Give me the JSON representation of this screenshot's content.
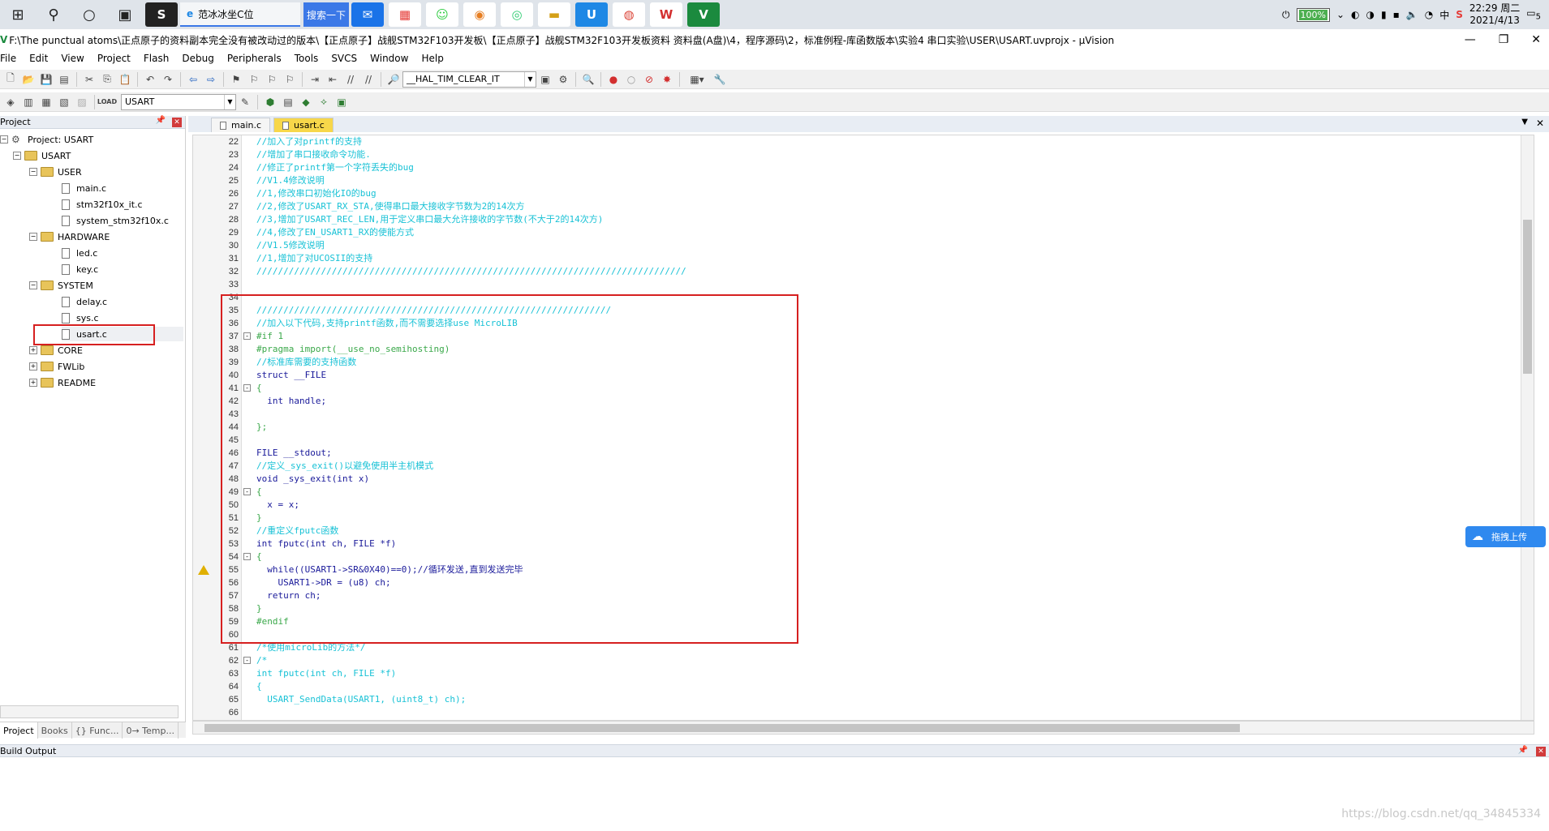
{
  "taskbar": {
    "ie_tab_label": "范冰冰坐C位",
    "search_label": "搜索一下",
    "battery": "100%",
    "time": "22:29 周二",
    "date": "2021/4/13",
    "notification_count": "5"
  },
  "window": {
    "title": "F:\\The punctual atoms\\正点原子的资料副本完全没有被改动过的版本\\【正点原子】战舰STM32F103开发板\\【正点原子】战舰STM32F103开发板资料 资料盘(A盘)\\4，程序源码\\2，标准例程-库函数版本\\实验4 串口实验\\USER\\USART.uvprojx - µVision"
  },
  "menu": [
    "File",
    "Edit",
    "View",
    "Project",
    "Flash",
    "Debug",
    "Peripherals",
    "Tools",
    "SVCS",
    "Window",
    "Help"
  ],
  "toolbar": {
    "find_combo": "__HAL_TIM_CLEAR_IT",
    "target_combo": "USART"
  },
  "project_panel": {
    "header": "Project",
    "root": "Project: USART",
    "target": "USART",
    "groups": [
      {
        "name": "USER",
        "files": [
          "main.c",
          "stm32f10x_it.c",
          "system_stm32f10x.c"
        ]
      },
      {
        "name": "HARDWARE",
        "files": [
          "led.c",
          "key.c"
        ]
      },
      {
        "name": "SYSTEM",
        "files": [
          "delay.c",
          "sys.c",
          "usart.c"
        ]
      },
      {
        "name": "CORE",
        "files": []
      },
      {
        "name": "FWLib",
        "files": []
      },
      {
        "name": "README",
        "files": []
      }
    ],
    "tabs": [
      "Project",
      "Books",
      "{} Func...",
      "0→ Temp..."
    ]
  },
  "editor": {
    "tabs": [
      "main.c",
      "usart.c"
    ],
    "lines": [
      {
        "n": "22",
        "t": "//加入了对printf的支持",
        "c": "comment"
      },
      {
        "n": "23",
        "t": "//增加了串口接收命令功能.",
        "c": "comment"
      },
      {
        "n": "24",
        "t": "//修正了printf第一个字符丢失的bug",
        "c": "comment"
      },
      {
        "n": "25",
        "t": "//V1.4修改说明",
        "c": "comment"
      },
      {
        "n": "26",
        "t": "//1,修改串口初始化IO的bug",
        "c": "comment"
      },
      {
        "n": "27",
        "t": "//2,修改了USART_RX_STA,使得串口最大接收字节数为2的14次方",
        "c": "comment"
      },
      {
        "n": "28",
        "t": "//3,增加了USART_REC_LEN,用于定义串口最大允许接收的字节数(不大于2的14次方)",
        "c": "comment"
      },
      {
        "n": "29",
        "t": "//4,修改了EN_USART1_RX的使能方式",
        "c": "comment"
      },
      {
        "n": "30",
        "t": "//V1.5修改说明",
        "c": "comment"
      },
      {
        "n": "31",
        "t": "//1,增加了对UCOSII的支持",
        "c": "comment"
      },
      {
        "n": "32",
        "t": "////////////////////////////////////////////////////////////////////////////////",
        "c": "comment"
      },
      {
        "n": "33",
        "t": "",
        "c": "plain"
      },
      {
        "n": "34",
        "t": "",
        "c": "plain"
      },
      {
        "n": "35",
        "t": "//////////////////////////////////////////////////////////////////",
        "c": "comment"
      },
      {
        "n": "36",
        "t": "//加入以下代码,支持printf函数,而不需要选择use MicroLIB",
        "c": "comment"
      },
      {
        "n": "37",
        "t": "#if 1",
        "c": "pp",
        "fold": "-"
      },
      {
        "n": "38",
        "t": "#pragma import(__use_no_semihosting)",
        "c": "pp"
      },
      {
        "n": "39",
        "t": "//标准库需要的支持函数",
        "c": "comment"
      },
      {
        "n": "40",
        "t": "struct __FILE",
        "c": "kw"
      },
      {
        "n": "41",
        "t": "{",
        "c": "pp",
        "fold": "-"
      },
      {
        "n": "42",
        "t": "  int handle;",
        "c": "kw"
      },
      {
        "n": "43",
        "t": "",
        "c": "plain"
      },
      {
        "n": "44",
        "t": "};",
        "c": "pp"
      },
      {
        "n": "45",
        "t": "",
        "c": "plain"
      },
      {
        "n": "46",
        "t": "FILE __stdout;",
        "c": "kw"
      },
      {
        "n": "47",
        "t": "//定义_sys_exit()以避免使用半主机模式",
        "c": "comment"
      },
      {
        "n": "48",
        "t": "void _sys_exit(int x)",
        "c": "kw"
      },
      {
        "n": "49",
        "t": "{",
        "c": "pp",
        "fold": "-"
      },
      {
        "n": "50",
        "t": "  x = x;",
        "c": "kw"
      },
      {
        "n": "51",
        "t": "}",
        "c": "pp"
      },
      {
        "n": "52",
        "t": "//重定义fputc函数",
        "c": "comment"
      },
      {
        "n": "53",
        "t": "int fputc(int ch, FILE *f)",
        "c": "kw"
      },
      {
        "n": "54",
        "t": "{",
        "c": "pp",
        "fold": "-"
      },
      {
        "n": "55",
        "t": "  while((USART1->SR&0X40)==0);//循环发送,直到发送完毕",
        "c": "kw"
      },
      {
        "n": "56",
        "t": "    USART1->DR = (u8) ch;",
        "c": "kw"
      },
      {
        "n": "57",
        "t": "  return ch;",
        "c": "kw"
      },
      {
        "n": "58",
        "t": "}",
        "c": "pp"
      },
      {
        "n": "59",
        "t": "#endif",
        "c": "pp"
      },
      {
        "n": "60",
        "t": "",
        "c": "plain"
      },
      {
        "n": "61",
        "t": "/*使用microLib的方法*/",
        "c": "comment"
      },
      {
        "n": "62",
        "t": "/*",
        "c": "comment",
        "fold": "-"
      },
      {
        "n": "63",
        "t": "int fputc(int ch, FILE *f)",
        "c": "comment"
      },
      {
        "n": "64",
        "t": "{",
        "c": "comment"
      },
      {
        "n": "65",
        "t": "  USART_SendData(USART1, (uint8_t) ch);",
        "c": "comment"
      },
      {
        "n": "66",
        "t": "",
        "c": "plain"
      }
    ]
  },
  "upload_label": "拖拽上传",
  "build_output": {
    "header": "Build Output"
  },
  "watermark": "https://blog.csdn.net/qq_34845334",
  "colors": {
    "accent": "#3b78e7",
    "highlight_box": "#d62020",
    "active_tab": "#f7d74a",
    "comment": "#19c2d6"
  }
}
